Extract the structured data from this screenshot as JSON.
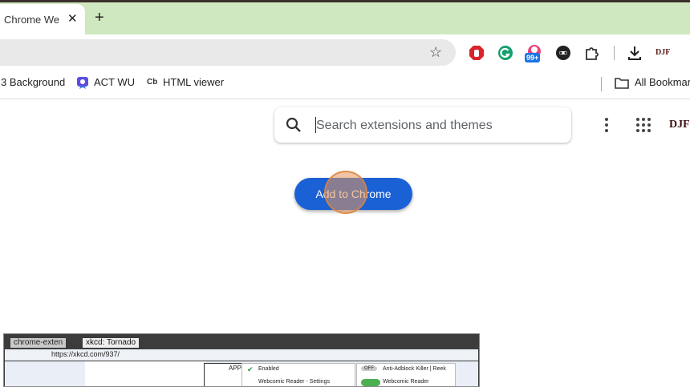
{
  "tabbar": {
    "tab_title": "Chrome Web Store",
    "close_glyph": "✕",
    "new_tab_glyph": "+"
  },
  "toolbar": {
    "extension_badge_count": "99+",
    "profile_text": "DJF"
  },
  "bookmarks": {
    "items": [
      {
        "label": "3 Background"
      },
      {
        "label": "ACT WU"
      },
      {
        "label": "HTML viewer",
        "prefix": "Cb"
      }
    ],
    "all_bookmarks": "All Bookmarks"
  },
  "page": {
    "search_placeholder": "Search extensions and themes",
    "add_button_label": "Add to Chrome",
    "profile_text": "DJF"
  },
  "screenshot_preview": {
    "tab1": "chrome-exten",
    "tab2": "xkcd: Tornado",
    "url": "https://xkcd.com/937/",
    "item_enabled": "Enabled",
    "item_reader_settings": "Webcomic Reader - Settings",
    "toggle_off": "OFF",
    "item_antiadblock": "Anti-Adblock Killer | Reek",
    "item_webcomic_reader": "Webcomic Reader",
    "comic_label": "APP"
  },
  "colors": {
    "tabbar_bg": "#cfe8c0",
    "accent_blue": "#1a61d6"
  },
  "icons": [
    "star-icon",
    "adblock-icon",
    "grammarly-icon",
    "extension-badge-icon",
    "puzzle-icon",
    "download-icon",
    "search-icon",
    "more-vert-icon",
    "apps-grid-icon",
    "folder-icon"
  ]
}
